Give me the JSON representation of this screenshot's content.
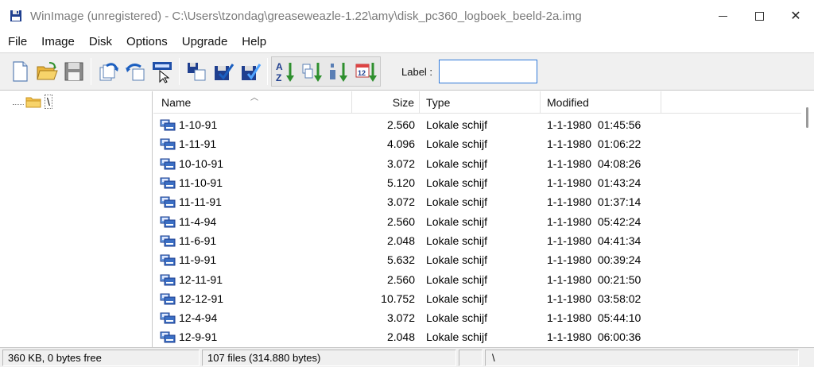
{
  "window": {
    "title": "WinImage (unregistered) - C:\\Users\\tzondag\\greaseweazle-1.22\\amy\\disk_pc360_logboek_beeld-2a.img",
    "controls": {
      "minimize": "—",
      "maximize": "☐",
      "close": "✕"
    }
  },
  "menu": [
    "File",
    "Image",
    "Disk",
    "Options",
    "Upgrade",
    "Help"
  ],
  "toolbar": {
    "label_text": "Label :",
    "label_value": "",
    "icons": [
      "new-file-icon",
      "open-folder-icon",
      "save-icon",
      "extract-icon",
      "inject-icon",
      "properties-icon",
      "copy-icon",
      "check-icon",
      "check-all-icon",
      "sort-name-icon",
      "sort-ext-icon",
      "sort-size-icon",
      "sort-date-icon"
    ]
  },
  "tree": {
    "root_label": "\\"
  },
  "list": {
    "columns": {
      "name": "Name",
      "size": "Size",
      "type": "Type",
      "modified": "Modified"
    },
    "rows": [
      {
        "name": "1-10-91",
        "size": "2.560",
        "type": "Lokale schijf",
        "modified": "1-1-1980  01:45:56"
      },
      {
        "name": "1-11-91",
        "size": "4.096",
        "type": "Lokale schijf",
        "modified": "1-1-1980  01:06:22"
      },
      {
        "name": "10-10-91",
        "size": "3.072",
        "type": "Lokale schijf",
        "modified": "1-1-1980  04:08:26"
      },
      {
        "name": "11-10-91",
        "size": "5.120",
        "type": "Lokale schijf",
        "modified": "1-1-1980  01:43:24"
      },
      {
        "name": "11-11-91",
        "size": "3.072",
        "type": "Lokale schijf",
        "modified": "1-1-1980  01:37:14"
      },
      {
        "name": "11-4-94",
        "size": "2.560",
        "type": "Lokale schijf",
        "modified": "1-1-1980  05:42:24"
      },
      {
        "name": "11-6-91",
        "size": "2.048",
        "type": "Lokale schijf",
        "modified": "1-1-1980  04:41:34"
      },
      {
        "name": "11-9-91",
        "size": "5.632",
        "type": "Lokale schijf",
        "modified": "1-1-1980  00:39:24"
      },
      {
        "name": "12-11-91",
        "size": "2.560",
        "type": "Lokale schijf",
        "modified": "1-1-1980  00:21:50"
      },
      {
        "name": "12-12-91",
        "size": "10.752",
        "type": "Lokale schijf",
        "modified": "1-1-1980  03:58:02"
      },
      {
        "name": "12-4-94",
        "size": "3.072",
        "type": "Lokale schijf",
        "modified": "1-1-1980  05:44:10"
      },
      {
        "name": "12-9-91",
        "size": "2.048",
        "type": "Lokale schijf",
        "modified": "1-1-1980  06:00:36"
      }
    ]
  },
  "status": {
    "free": "360 KB, 0 bytes free",
    "files": "107 files (314.880 bytes)",
    "blank": "",
    "path": "\\"
  },
  "colors": {
    "accent": "#2f78d8",
    "folder": "#f2c14e",
    "toolbar_bg": "#f0f0f0"
  }
}
